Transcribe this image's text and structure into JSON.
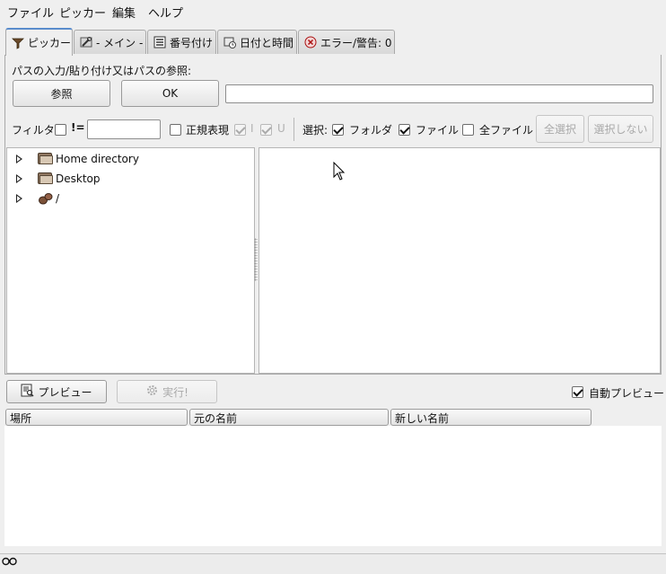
{
  "menubar": {
    "items": [
      "ファイル",
      "ピッカー",
      "編集",
      "ヘルプ"
    ]
  },
  "tabs": [
    {
      "label": "ピッカー",
      "icon": "filter-funnel-icon",
      "active": true
    },
    {
      "label": "- メイン -",
      "icon": "wrench-icon",
      "active": false
    },
    {
      "label": "番号付け",
      "icon": "numbered-list-icon",
      "active": false
    },
    {
      "label": "日付と時間",
      "icon": "clock-calendar-icon",
      "active": false
    },
    {
      "label": "エラー/警告: 0",
      "icon": "error-circle-icon",
      "active": false
    }
  ],
  "picker": {
    "path_prompt": "パスの入力/貼り付け又はパスの参照:",
    "browse_label": "参照",
    "ok_label": "OK",
    "path_value": ""
  },
  "filter": {
    "label": "フィルタ:",
    "enabled": false,
    "not_label": "!=",
    "filter_value": "",
    "regex_label": "正規表現",
    "regex_checked": false,
    "i_label": "I",
    "i_checked": true,
    "u_label": "U",
    "u_checked": true
  },
  "selection": {
    "label": "選択:",
    "folder_label": "フォルダ",
    "folder_checked": true,
    "file_label": "ファイル",
    "file_checked": true,
    "allfiles_label": "全ファイル",
    "allfiles_checked": false,
    "select_all_label": "全選択",
    "select_none_label": "選択しない"
  },
  "tree": [
    {
      "label": "Home directory",
      "icon": "folder-icon"
    },
    {
      "label": "Desktop",
      "icon": "folder-icon"
    },
    {
      "label": "/",
      "icon": "drive-root-icon"
    }
  ],
  "actions": {
    "preview_label": "プレビュー",
    "run_label": "実行!",
    "auto_preview_label": "自動プレビュー",
    "auto_preview_checked": true
  },
  "results": {
    "columns": [
      "場所",
      "元の名前",
      "新しい名前"
    ]
  },
  "status": {
    "icon": "status-glasses-icon"
  },
  "colors": {
    "active_tab_accent": "#5a8ccc",
    "background": "#efefef"
  }
}
